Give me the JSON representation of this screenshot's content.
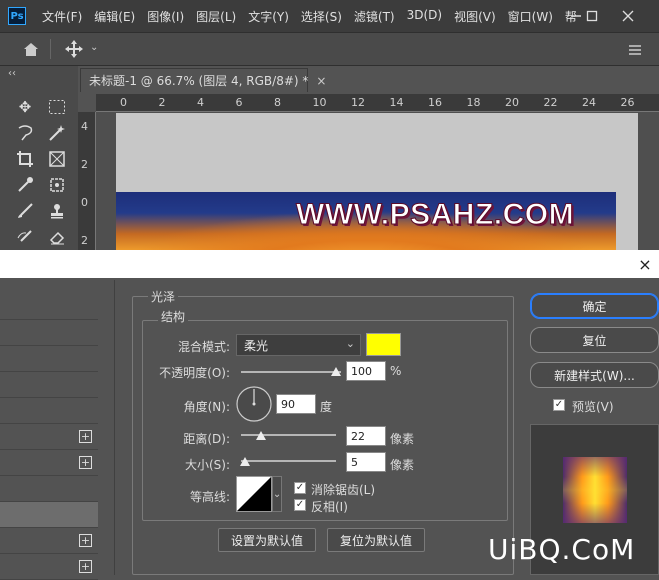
{
  "app": {
    "logo_text": "Ps"
  },
  "menu": [
    "文件(F)",
    "编辑(E)",
    "图像(I)",
    "图层(L)",
    "文字(Y)",
    "选择(S)",
    "滤镜(T)",
    "3D(D)",
    "视图(V)",
    "窗口(W)",
    "帮"
  ],
  "doc_tab": {
    "title": "未标题-1 @ 66.7% (图层 4, RGB/8#) *",
    "close": "×"
  },
  "ruler": {
    "h_ticks": [
      "0",
      "2",
      "4",
      "6",
      "8",
      "10",
      "12",
      "14",
      "16",
      "18",
      "20",
      "22",
      "24",
      "26"
    ],
    "v_ticks": [
      "4",
      "2",
      "0",
      "2"
    ]
  },
  "artwork": {
    "text": "WWW.PSAHZ.COM"
  },
  "dialog": {
    "close": "×",
    "section_title": "光泽",
    "group_title": "结构",
    "blend_mode_label": "混合模式:",
    "blend_mode_value": "柔光",
    "blend_color": "#ffff00",
    "opacity_label": "不透明度(O):",
    "opacity_value": "100",
    "opacity_unit": "%",
    "opacity_level": 1.0,
    "angle_label": "角度(N):",
    "angle_value": "90",
    "angle_unit": "度",
    "distance_label": "距离(D):",
    "distance_value": "22",
    "distance_unit": "像素",
    "size_label": "大小(S):",
    "size_value": "5",
    "size_unit": "像素",
    "contour_label": "等高线:",
    "antialias_label": "消除锯齿(L)",
    "antialias_checked": true,
    "invert_label": "反相(I)",
    "invert_checked": true,
    "set_default_label": "设置为默认值",
    "reset_default_label": "复位为默认值",
    "ok_label": "确定",
    "reset_label": "复位",
    "new_style_label": "新建样式(W)...",
    "preview_label": "预览(V)",
    "preview_checked": true
  },
  "watermark": "UiBQ.CoM"
}
